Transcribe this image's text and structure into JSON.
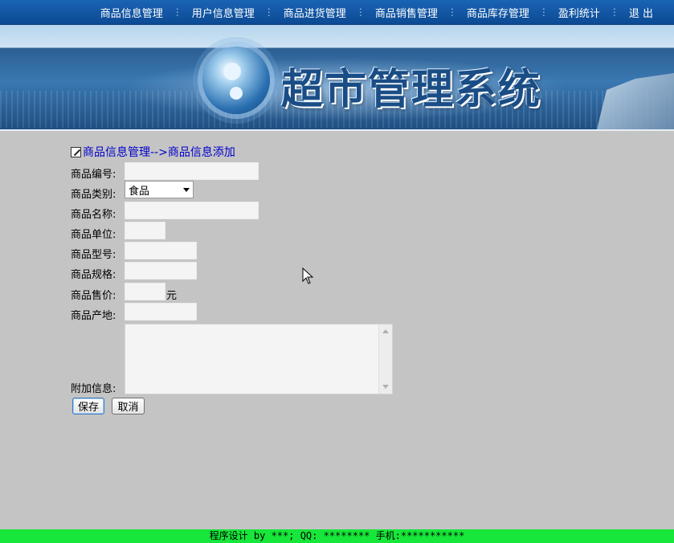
{
  "top_nav": {
    "items": [
      "商品信息管理",
      "用户信息管理",
      "商品进货管理",
      "商品销售管理",
      "商品库存管理",
      "盈利统计",
      "退 出"
    ],
    "separator": "⋮"
  },
  "banner": {
    "title": "超市管理系统"
  },
  "breadcrumb": {
    "text": "商品信息管理-->商品信息添加"
  },
  "form": {
    "labels": {
      "code": "商品编号:",
      "category": "商品类别:",
      "name": "商品名称:",
      "unit": "商品单位:",
      "model": "商品型号:",
      "spec": "商品规格:",
      "price": "商品售价:",
      "origin": "商品产地:",
      "extra": "附加信息:"
    },
    "values": {
      "code": "",
      "name": "",
      "unit": "",
      "model": "",
      "spec": "",
      "price": "",
      "origin": "",
      "extra": ""
    },
    "category_selected": "食品",
    "price_unit": "元"
  },
  "buttons": {
    "save": "保存",
    "cancel": "取消"
  },
  "footer": {
    "text": "程序设计 by ***; QQ: ******** 手机:***********"
  },
  "colors": {
    "nav_bg": "#1a64b4",
    "page_bg": "#c4c4c4",
    "footer_bg": "#17e63a",
    "link": "#0000cc"
  },
  "icons": {
    "breadcrumb": "edit-icon",
    "cursor": "mouse-pointer-icon"
  }
}
